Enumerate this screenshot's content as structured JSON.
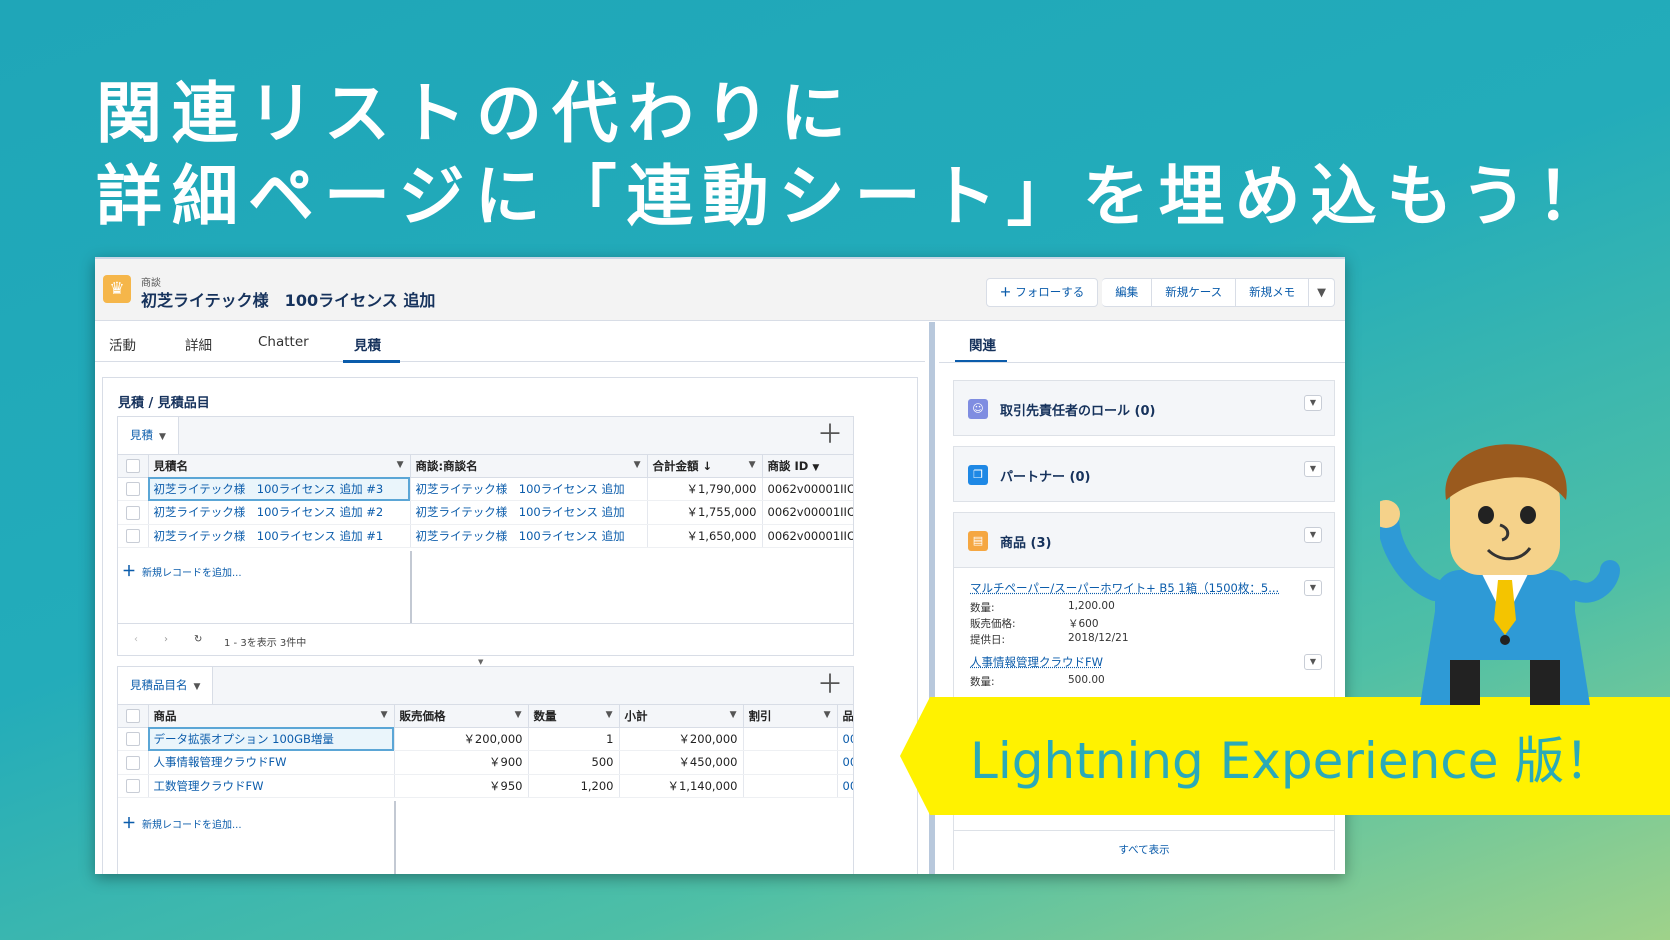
{
  "headline": {
    "line1": "関連リストの代わりに",
    "line2": "詳細ページに「連動シート」を埋め込もう！"
  },
  "record": {
    "type": "商談",
    "name": "初芝ライテック様　100ライセンス 追加",
    "icon": "crown-icon",
    "actions": {
      "follow": "フォローする",
      "edit": "編集",
      "new_case": "新規ケース",
      "new_memo": "新規メモ"
    }
  },
  "tabs": [
    "活動",
    "詳細",
    "Chatter",
    "見積"
  ],
  "card_title": "見積 / 見積品目",
  "quote_grid": {
    "object_label": "見積",
    "columns": [
      "見積名",
      "商談:商談名",
      "合計金額 ↓",
      "商談 ID"
    ],
    "rows": [
      {
        "name": "初芝ライテック様　100ライセンス 追加 #3",
        "opp": "初芝ライテック様　100ライセンス 追加",
        "total": "￥1,790,000",
        "opp_id": "0062v00001IIO"
      },
      {
        "name": "初芝ライテック様　100ライセンス 追加 #2",
        "opp": "初芝ライテック様　100ライセンス 追加",
        "total": "￥1,755,000",
        "opp_id": "0062v00001IIO"
      },
      {
        "name": "初芝ライテック様　100ライセンス 追加 #1",
        "opp": "初芝ライテック様　100ライセンス 追加",
        "total": "￥1,650,000",
        "opp_id": "0062v00001IIO"
      }
    ],
    "add_record": "新規レコードを追加...",
    "pager_text": "1 - 3を表示 3件中"
  },
  "item_grid": {
    "object_label": "見積品目名",
    "columns": [
      "商品",
      "販売価格",
      "数量",
      "小計",
      "割引",
      "品"
    ],
    "rows": [
      {
        "product": "データ拡張オプション 100GB増量",
        "price": "￥200,000",
        "qty": "1",
        "subtotal": "￥200,000",
        "discount": "",
        "extra": "00"
      },
      {
        "product": "人事情報管理クラウドFW",
        "price": "￥900",
        "qty": "500",
        "subtotal": "￥450,000",
        "discount": "",
        "extra": "00"
      },
      {
        "product": "工数管理クラウドFW",
        "price": "￥950",
        "qty": "1,200",
        "subtotal": "￥1,140,000",
        "discount": "",
        "extra": "00"
      }
    ],
    "add_record": "新規レコードを追加..."
  },
  "related": {
    "tab": "関連",
    "cards": [
      {
        "title": "取引先責任者のロール (0)",
        "icon": "contact-role-icon",
        "color": "#7f8de1"
      },
      {
        "title": "パートナー (0)",
        "icon": "partner-icon",
        "color": "#1e88e5"
      },
      {
        "title": "商品 (3)",
        "icon": "product-icon",
        "color": "#f5a742"
      }
    ],
    "products": [
      {
        "name": "マルチペーパー/スーパーホワイト+ B5 1箱（1500枚：5...",
        "qty_label": "数量:",
        "qty": "1,200.00",
        "price_label": "販売価格:",
        "price": "￥600",
        "date_label": "提供日:",
        "date": "2018/12/21"
      },
      {
        "name": "人事情報管理クラウドFW",
        "qty_label": "数量:",
        "qty": "500.00"
      }
    ],
    "view_all": "すべて表示"
  },
  "banner": "Lightning Experience 版！"
}
